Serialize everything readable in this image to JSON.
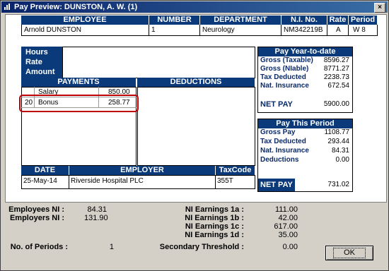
{
  "window": {
    "title": "Pay Preview: DUNSTON, A. W. (1)",
    "close": "×"
  },
  "employee_table": {
    "headers": {
      "employee": "EMPLOYEE",
      "number": "NUMBER",
      "department": "DEPARTMENT",
      "ni_no": "N.I. No.",
      "rate": "Rate",
      "period": "Period"
    },
    "row": {
      "employee": "Arnold DUNSTON",
      "number": "1",
      "department": "Neurology",
      "ni_no": "NM342219B",
      "rate": "A",
      "period": "W 8"
    }
  },
  "hours_box": {
    "hours": "Hours",
    "rate": "Rate",
    "amount": "Amount"
  },
  "payments": {
    "header": "PAYMENTS",
    "rows": [
      {
        "code": "",
        "name": "Salary",
        "amount": "850.00"
      },
      {
        "code": "20",
        "name": "Bonus",
        "amount": "258.77"
      }
    ]
  },
  "deductions": {
    "header": "DEDUCTIONS"
  },
  "ytd": {
    "header": "Pay Year-to-date",
    "rows": [
      {
        "label": "Gross (Taxable)",
        "value": "8596.27"
      },
      {
        "label": "Gross (NIable)",
        "value": "8771.27"
      },
      {
        "label": "Tax Deducted",
        "value": "2238.73"
      },
      {
        "label": "Nat. Insurance",
        "value": "672.54"
      }
    ],
    "net_label": "NET PAY",
    "net_value": "5900.00"
  },
  "this_period": {
    "header": "Pay This Period",
    "rows": [
      {
        "label": "Gross Pay",
        "value": "1108.77"
      },
      {
        "label": "Tax Deducted",
        "value": "293.44"
      },
      {
        "label": "Nat. Insurance",
        "value": "84.31"
      },
      {
        "label": "Deductions",
        "value": "0.00"
      }
    ],
    "net_label": "NET PAY",
    "net_value": "731.02"
  },
  "date_table": {
    "headers": {
      "date": "DATE",
      "employer": "EMPLOYER",
      "taxcode": "TaxCode"
    },
    "row": {
      "date": "25-May-14",
      "employer": "Riverside Hospital PLC",
      "taxcode": "355T"
    }
  },
  "bottom": {
    "employees_ni_label": "Employees NI :",
    "employees_ni": "84.31",
    "employers_ni_label": "Employers NI :",
    "employers_ni": "131.90",
    "periods_label": "No. of Periods :",
    "periods": "1",
    "ni1a_label": "NI Earnings 1a :",
    "ni1a": "111.00",
    "ni1b_label": "NI Earnings 1b :",
    "ni1b": "42.00",
    "ni1c_label": "NI Earnings 1c :",
    "ni1c": "617.00",
    "ni1d_label": "NI Earnings 1d :",
    "ni1d": "35.00",
    "sec_label": "Secondary Threshold :",
    "sec": "0.00"
  },
  "ok_label": "OK",
  "colors": {
    "header_blue": "#0a3a7a",
    "highlight_red": "#c00000",
    "face": "#d4d0c8"
  }
}
